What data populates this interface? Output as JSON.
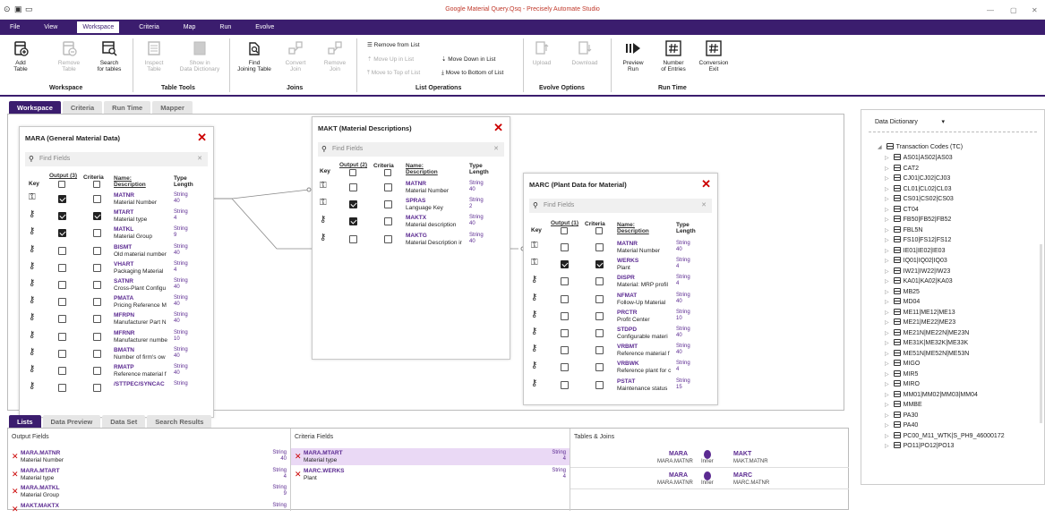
{
  "window": {
    "title": "Google Material Query.Qsq - Precisely Automate Studio"
  },
  "menu": [
    "File",
    "View",
    "Workspace",
    "Criteria",
    "Map",
    "Run",
    "Evolve"
  ],
  "ribbon": {
    "add_table": "Add\nTable",
    "remove_table": "Remove\nTable",
    "search_tables": "Search\nfor tables",
    "inspect_table": "Inspect\nTable",
    "show_dd": "Show in\nData Dictionary",
    "find_joining": "Find\nJoining Table",
    "convert_join": "Convert\nJoin",
    "remove_join": "Remove\nJoin",
    "remove_from_list": "Remove from List",
    "move_up": "Move Up in List",
    "move_down": "Move Down in List",
    "move_top": "Move to Top of List",
    "move_bottom": "Move to Bottom of List",
    "upload": "Upload",
    "download": "Download",
    "preview_run": "Preview\nRun",
    "number_entries": "Number\nof Entries",
    "conversion_exit": "Conversion\nExit",
    "groups": {
      "workspace": "Workspace",
      "table_tools": "Table Tools",
      "joins": "Joins",
      "list_operations": "List Operations",
      "evolve_options": "Evolve Options",
      "run_time": "Run Time"
    }
  },
  "tabs": [
    "Workspace",
    "Criteria",
    "Run Time",
    "Mapper"
  ],
  "common": {
    "find_fields": "Find Fields",
    "key": "Key",
    "criteria": "Criteria",
    "name": "Name:",
    "description": "Description",
    "type": "Type",
    "length": "Length"
  },
  "tables": {
    "mara": {
      "title": "MARA (General Material Data)",
      "output_count": "Output (3)",
      "fields": [
        {
          "name": "MATNR",
          "desc": "Material Number",
          "type": "String",
          "len": "40",
          "key": true,
          "out": true,
          "crit": false
        },
        {
          "name": "MTART",
          "desc": "Material type",
          "type": "String",
          "len": "4",
          "key": false,
          "out": true,
          "crit": true
        },
        {
          "name": "MATKL",
          "desc": "Material Group",
          "type": "String",
          "len": "9",
          "key": false,
          "out": true,
          "crit": false
        },
        {
          "name": "BISMT",
          "desc": "Old material number",
          "type": "String",
          "len": "40",
          "key": false,
          "out": false,
          "crit": false
        },
        {
          "name": "VHART",
          "desc": "Packaging Material",
          "type": "String",
          "len": "4",
          "key": false,
          "out": false,
          "crit": false
        },
        {
          "name": "SATNR",
          "desc": "Cross-Plant Configu",
          "type": "String",
          "len": "40",
          "key": false,
          "out": false,
          "crit": false
        },
        {
          "name": "PMATA",
          "desc": "Pricing Reference M",
          "type": "String",
          "len": "40",
          "key": false,
          "out": false,
          "crit": false
        },
        {
          "name": "MFRPN",
          "desc": "Manufacturer Part N",
          "type": "String",
          "len": "40",
          "key": false,
          "out": false,
          "crit": false
        },
        {
          "name": "MFRNR",
          "desc": "Manufacturer numbe",
          "type": "String",
          "len": "10",
          "key": false,
          "out": false,
          "crit": false
        },
        {
          "name": "BMATN",
          "desc": "Number of firm's ow",
          "type": "String",
          "len": "40",
          "key": false,
          "out": false,
          "crit": false
        },
        {
          "name": "RMATP",
          "desc": "Reference material f",
          "type": "String",
          "len": "40",
          "key": false,
          "out": false,
          "crit": false
        },
        {
          "name": "/STTPEC/SYNCAC",
          "desc": "",
          "type": "String",
          "len": "",
          "key": false,
          "out": false,
          "crit": false
        }
      ]
    },
    "makt": {
      "title": "MAKT (Material Descriptions)",
      "output_count": "Output (2)",
      "fields": [
        {
          "name": "MATNR",
          "desc": "Material Number",
          "type": "String",
          "len": "40",
          "key": true,
          "out": false,
          "crit": false
        },
        {
          "name": "SPRAS",
          "desc": "Language Key",
          "type": "String",
          "len": "2",
          "key": true,
          "out": true,
          "crit": false
        },
        {
          "name": "MAKTX",
          "desc": "Material description",
          "type": "String",
          "len": "40",
          "key": false,
          "out": true,
          "crit": false
        },
        {
          "name": "MAKTG",
          "desc": "Material Description ir",
          "type": "String",
          "len": "40",
          "key": false,
          "out": false,
          "crit": false
        }
      ]
    },
    "marc": {
      "title": "MARC (Plant Data for Material)",
      "output_count": "Output (1)",
      "fields": [
        {
          "name": "MATNR",
          "desc": "Material Number",
          "type": "String",
          "len": "40",
          "key": true,
          "out": false,
          "crit": false
        },
        {
          "name": "WERKS",
          "desc": "Plant",
          "type": "String",
          "len": "4",
          "key": true,
          "out": true,
          "crit": true
        },
        {
          "name": "DISPR",
          "desc": "Material: MRP profil",
          "type": "String",
          "len": "4",
          "key": false,
          "out": false,
          "crit": false
        },
        {
          "name": "NFMAT",
          "desc": "Follow-Up Material",
          "type": "String",
          "len": "40",
          "key": false,
          "out": false,
          "crit": false
        },
        {
          "name": "PRCTR",
          "desc": "Profit Center",
          "type": "String",
          "len": "10",
          "key": false,
          "out": false,
          "crit": false
        },
        {
          "name": "STDPD",
          "desc": "Configurable materi",
          "type": "String",
          "len": "40",
          "key": false,
          "out": false,
          "crit": false
        },
        {
          "name": "VRBMT",
          "desc": "Reference material f",
          "type": "String",
          "len": "40",
          "key": false,
          "out": false,
          "crit": false
        },
        {
          "name": "VRBWK",
          "desc": "Reference plant for c",
          "type": "String",
          "len": "4",
          "key": false,
          "out": false,
          "crit": false
        },
        {
          "name": "PSTAT",
          "desc": "Maintenance status",
          "type": "String",
          "len": "15",
          "key": false,
          "out": false,
          "crit": false
        }
      ]
    }
  },
  "bottom_tabs": [
    "Lists",
    "Data Preview",
    "Data Set",
    "Search Results"
  ],
  "lists": {
    "output_header": "Output Fields",
    "criteria_header": "Criteria Fields",
    "joins_header": "Tables & Joins",
    "output": [
      {
        "name": "MARA.MATNR",
        "desc": "Material Number",
        "type": "String",
        "len": "40"
      },
      {
        "name": "MARA.MTART",
        "desc": "Material type",
        "type": "String",
        "len": "4"
      },
      {
        "name": "MARA.MATKL",
        "desc": "Material Group",
        "type": "String",
        "len": "9"
      },
      {
        "name": "MAKT.MAKTX",
        "desc": "",
        "type": "String",
        "len": ""
      }
    ],
    "criteria": [
      {
        "name": "MARA.MTART",
        "desc": "Material type",
        "type": "String",
        "len": "4"
      },
      {
        "name": "MARC.WERKS",
        "desc": "Plant",
        "type": "String",
        "len": "4"
      }
    ],
    "joins": [
      {
        "left": "MARA",
        "left_key": "MARA.MATNR",
        "kind": "Inner",
        "right": "MAKT",
        "right_key": "MAKT.MATNR"
      },
      {
        "left": "MARA",
        "left_key": "MARA.MATNR",
        "kind": "Inner",
        "right": "MARC",
        "right_key": "MARC.MATNR"
      }
    ]
  },
  "dictionary": {
    "selector": "Data Dictionary",
    "root": "Transaction Codes (TC)",
    "items": [
      "AS01|AS02|AS03",
      "CAT2",
      "CJ01|CJ02|CJ03",
      "CL01|CL02|CL03",
      "CS01|CS02|CS03",
      "CT04",
      "FB50|FB52|FB52",
      "FBL5N",
      "FS10|FS12|FS12",
      "IE01|IE02|IE03",
      "IQ01|IQ02|IQ03",
      "IW21|IW22|IW23",
      "KA01|KA02|KA03",
      "MB25",
      "MD04",
      "ME11|ME12|ME13",
      "ME21|ME22|ME23",
      "ME21N|ME22N|ME23N",
      "ME31K|ME32K|ME33K",
      "ME51N|ME52N|ME53N",
      "MIGO",
      "MIR5",
      "MIRO",
      "MM01|MM02|MM03|MM04",
      "MMBE",
      "PA30",
      "PA40",
      "PC00_M11_WTK|S_PH9_46000172",
      "PO11|PO12|PO13"
    ]
  }
}
